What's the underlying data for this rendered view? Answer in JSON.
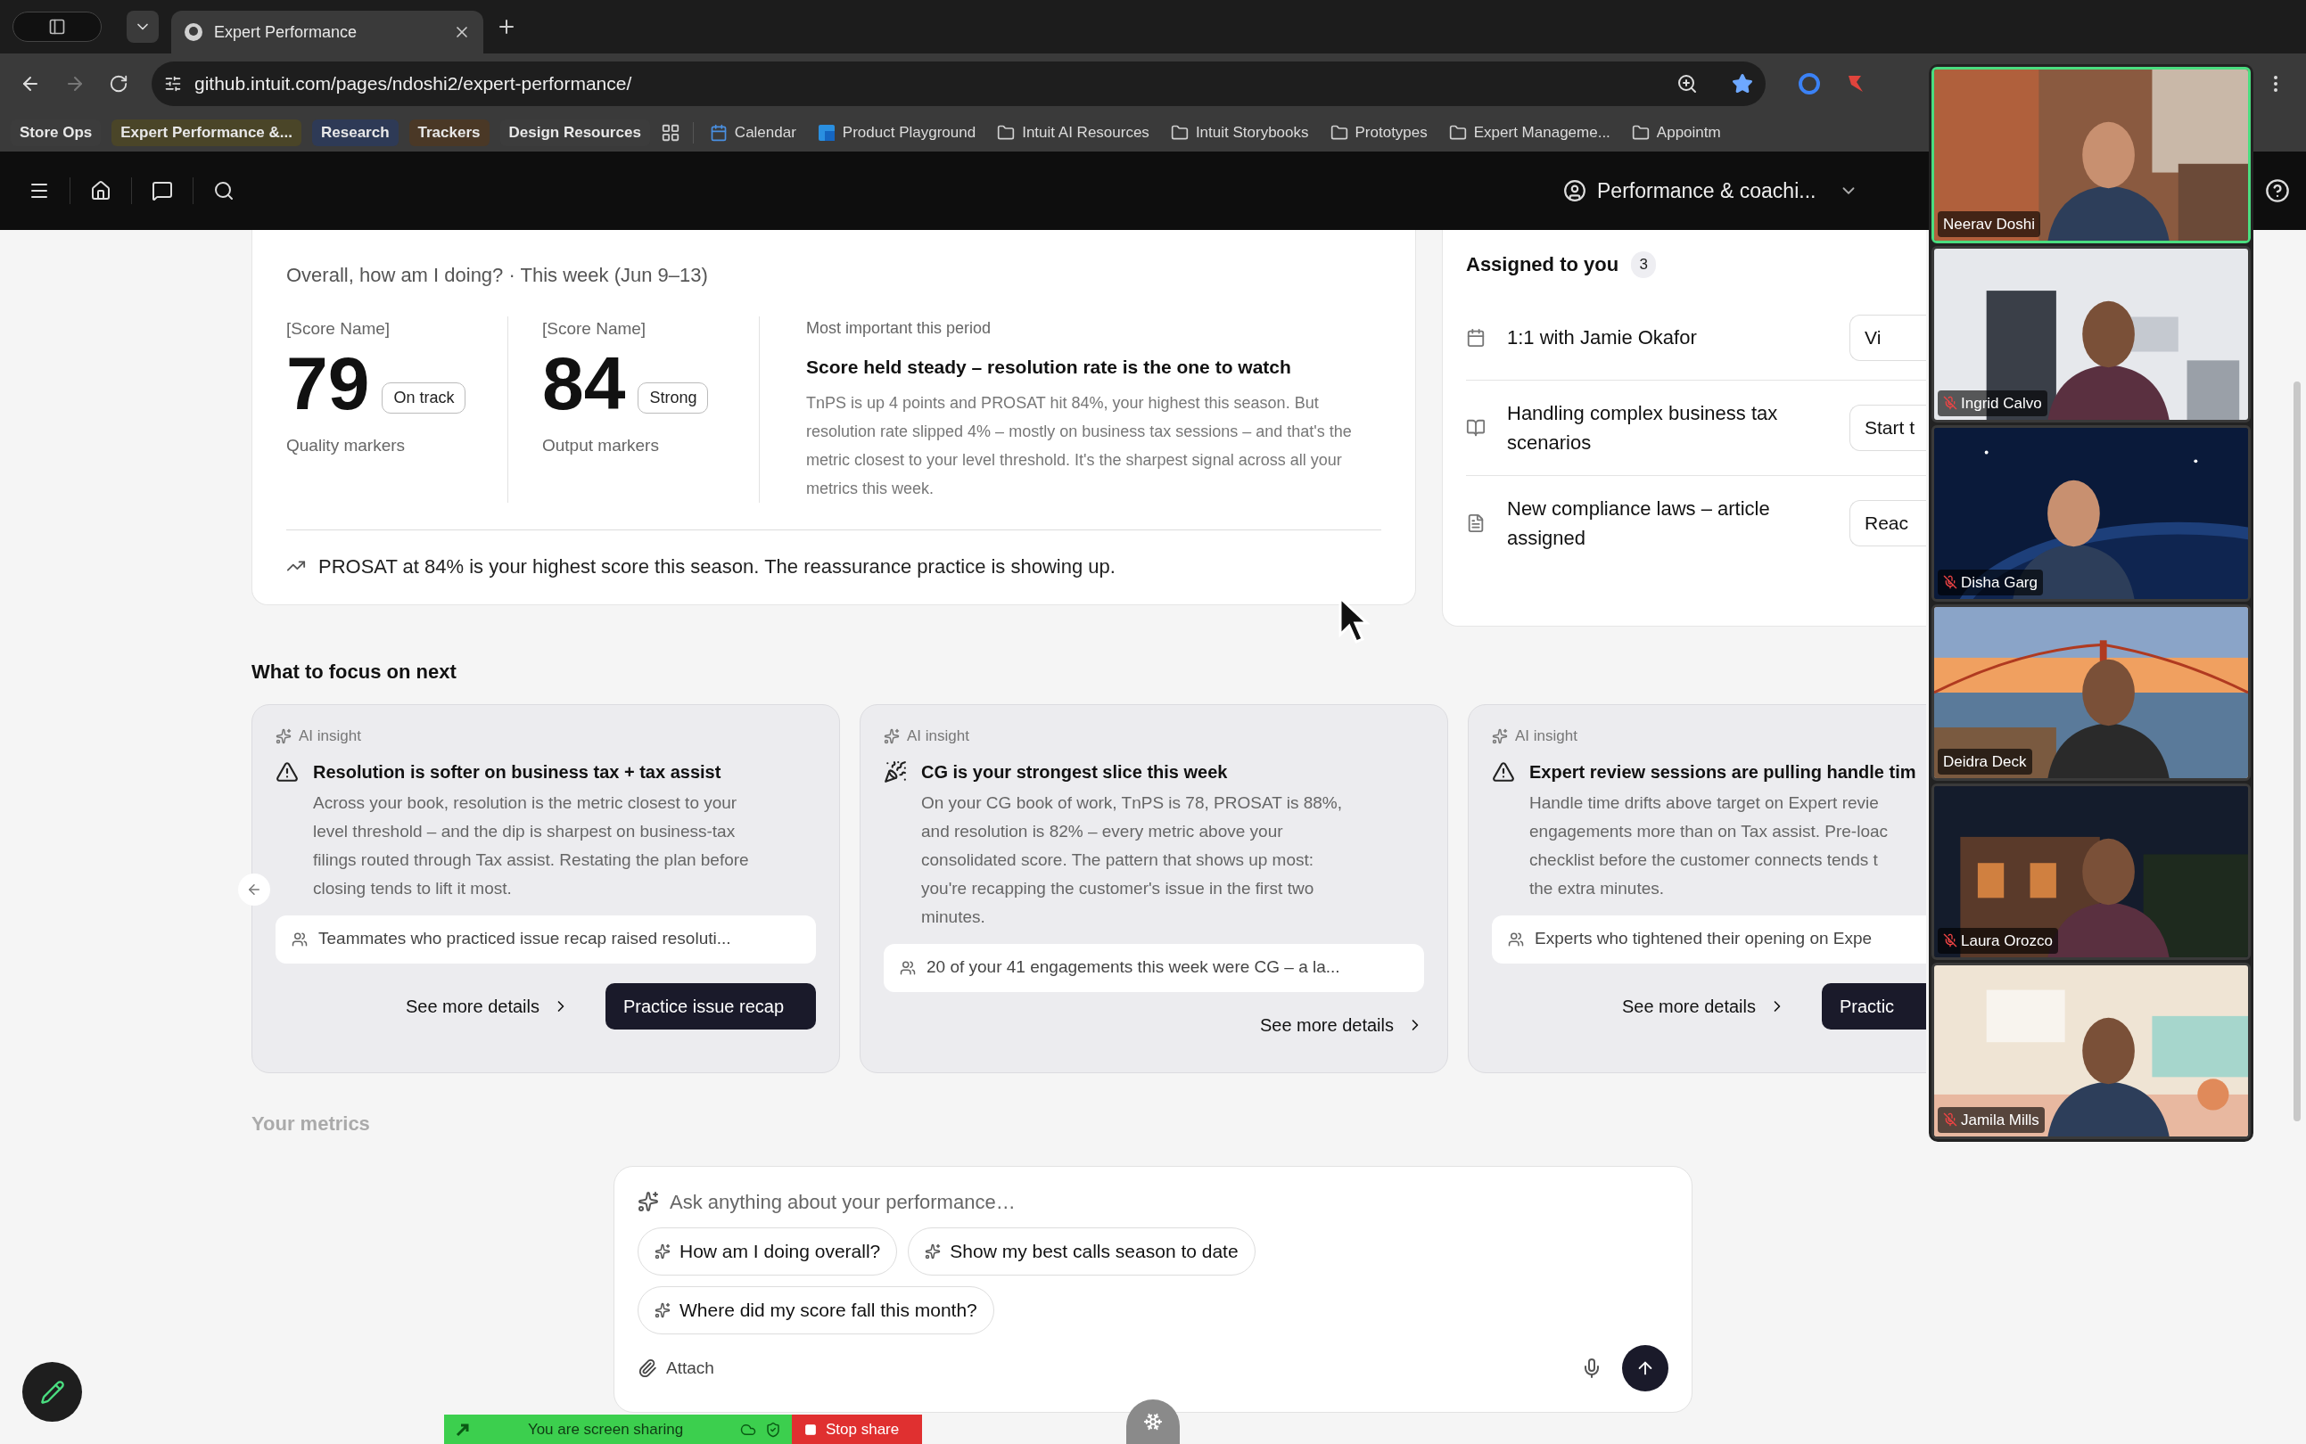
{
  "browser": {
    "tab_title": "Expert Performance",
    "url": "github.intuit.com/pages/ndoshi2/expert-performance/",
    "bookmarks": [
      {
        "kind": "group",
        "label": "Store Ops",
        "color": "#3c3c3c"
      },
      {
        "kind": "group",
        "label": "Expert Performance &...",
        "color": "#4a4528"
      },
      {
        "kind": "group",
        "label": "Research",
        "color": "#2e3a56"
      },
      {
        "kind": "group",
        "label": "Trackers",
        "color": "#4a3826"
      },
      {
        "kind": "group",
        "label": "Design Resources",
        "color": "#3c3c3c"
      },
      {
        "kind": "apps"
      },
      {
        "kind": "calendar",
        "label": "Calendar"
      },
      {
        "kind": "site",
        "label": "Product Playground"
      },
      {
        "kind": "folder",
        "label": "Intuit AI Resources"
      },
      {
        "kind": "folder",
        "label": "Intuit Storybooks"
      },
      {
        "kind": "folder",
        "label": "Prototypes"
      },
      {
        "kind": "folder",
        "label": "Expert Manageme..."
      },
      {
        "kind": "folder",
        "label": "Appointm"
      }
    ]
  },
  "nav": {
    "workspace": "Performance & coachi..."
  },
  "overview": {
    "title": "Overall, how am I doing? · This week (Jun 9–13)",
    "scores": [
      {
        "label": "[Score Name]",
        "value": "79",
        "badge": "On track",
        "caption": "Quality markers"
      },
      {
        "label": "[Score Name]",
        "value": "84",
        "badge": "Strong",
        "caption": "Output markers"
      }
    ],
    "highlight": {
      "eyebrow": "Most important this period",
      "title": "Score held steady – resolution rate is the one to watch",
      "body": "TnPS is up 4 points and PROSAT hit 84%, your highest this season. But resolution rate slipped 4% – mostly on business tax sessions – and that's the metric closest to your level threshold. It's the sharpest signal across all your metrics this week."
    },
    "trend": "PROSAT at 84% is your highest score this season. The reassurance practice is showing up."
  },
  "assigned": {
    "title": "Assigned to you",
    "count": "3",
    "items": [
      {
        "kind": "meeting",
        "title": "1:1 with Jamie Okafor",
        "action": "Vi"
      },
      {
        "kind": "course",
        "title": "Handling complex business tax scenarios",
        "action": "Start t"
      },
      {
        "kind": "article",
        "title": "New compliance laws – article assigned",
        "action": "Reac"
      }
    ]
  },
  "focus": {
    "title": "What to focus on next",
    "cards": [
      {
        "tag": "AI insight",
        "kind": "warning",
        "title": "Resolution is softer on business tax + tax assist",
        "body_lines": [
          "Across your book, resolution is the metric closest to your",
          "level threshold – and the dip is sharpest on business-tax",
          "filings routed through Tax assist. Restating the plan before",
          "closing tends to lift it most."
        ],
        "note": "Teammates who practiced issue recap raised resoluti...",
        "link": "See more details",
        "action": "Practice issue recap"
      },
      {
        "tag": "AI insight",
        "kind": "celebrate",
        "title": "CG is your strongest slice this week",
        "body_lines": [
          "On your CG book of work, TnPS is 78, PROSAT is 88%,",
          "and resolution is 82% – every metric above your",
          "consolidated score. The pattern that shows up most:",
          "you're recapping the customer's issue in the first two",
          "minutes."
        ],
        "note": "20 of your 41 engagements this week were CG – a la...",
        "link": "See more details"
      },
      {
        "tag": "AI insight",
        "kind": "warning",
        "title": "Expert review sessions are pulling handle tim",
        "body_lines": [
          "Handle time drifts above target on Expert revie",
          "engagements more than on Tax assist. Pre-loac",
          "checklist before the customer connects tends t",
          "the extra minutes."
        ],
        "note": "Experts who tightened their opening on Expe",
        "link": "See more details",
        "action": "Practic"
      }
    ]
  },
  "metrics": {
    "title": "Your metrics"
  },
  "chat": {
    "placeholder": "Ask anything about your performance…",
    "suggestions": [
      "How am I doing overall?",
      "Show my best calls season to date",
      "Where did my score fall this month?"
    ],
    "attach": "Attach"
  },
  "share_bar": {
    "status": "You are screen sharing",
    "stop": "Stop share"
  },
  "participants": [
    {
      "name": "Neerav Doshi",
      "muted": false,
      "speaking": true
    },
    {
      "name": "Ingrid Calvo",
      "muted": true,
      "speaking": false
    },
    {
      "name": "Disha Garg",
      "muted": true,
      "speaking": false
    },
    {
      "name": "Deidra Deck",
      "muted": false,
      "speaking": false
    },
    {
      "name": "Laura Orozco",
      "muted": true,
      "speaking": false
    },
    {
      "name": "Jamila Mills",
      "muted": true,
      "speaking": false
    }
  ]
}
